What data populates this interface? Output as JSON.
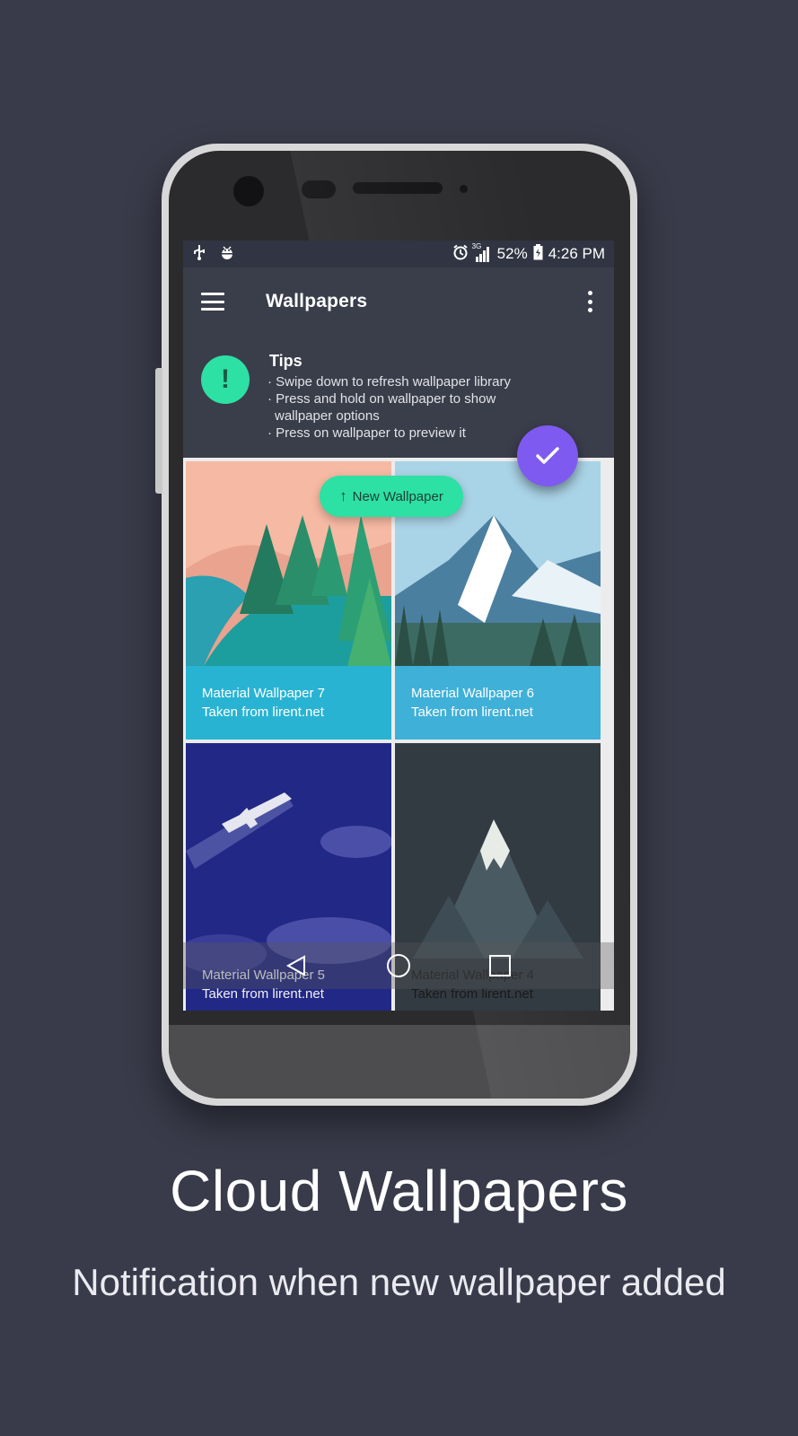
{
  "status_bar": {
    "battery": "52%",
    "time": "4:26 PM",
    "network": "3G",
    "icons_left": [
      "usb-icon",
      "android-debug-icon"
    ],
    "icons_right": [
      "alarm-icon",
      "signal-icon",
      "battery-icon"
    ]
  },
  "app_bar": {
    "title": "Wallpapers",
    "menu_icon": "hamburger-menu-icon",
    "overflow_icon": "more-vert-icon"
  },
  "tips": {
    "badge": "!",
    "title": "Tips",
    "items": [
      "· Swipe down to refresh wallpaper library",
      "· Press and hold on wallpaper to show wallpaper options",
      "· Press on wallpaper to preview it"
    ]
  },
  "new_wallpaper_chip": {
    "arrow": "↑",
    "label": "New Wallpaper"
  },
  "fab": {
    "icon": "check-icon",
    "color": "#7f5af0"
  },
  "wallpapers": [
    {
      "name": "Material Wallpaper 7",
      "source": "Taken from lirent.net",
      "caption_color": "#29b3d3"
    },
    {
      "name": "Material Wallpaper 6",
      "source": "Taken from lirent.net",
      "caption_color": "#3fb0d8"
    },
    {
      "name": "Material Wallpaper 5",
      "source": "Taken from lirent.net",
      "caption_color": "#2a2f86"
    },
    {
      "name": "Material Wallpaper 4",
      "source": "Taken from lirent.net",
      "caption_color": "#d6d6d6"
    }
  ],
  "nav_bar": {
    "back": "back-icon",
    "home": "home-icon",
    "recents": "recents-icon"
  },
  "hero": {
    "title": "Cloud Wallpapers",
    "subtitle": "Notification when new wallpaper added"
  },
  "colors": {
    "background": "#393b4a",
    "accent": "#2de0a3"
  }
}
